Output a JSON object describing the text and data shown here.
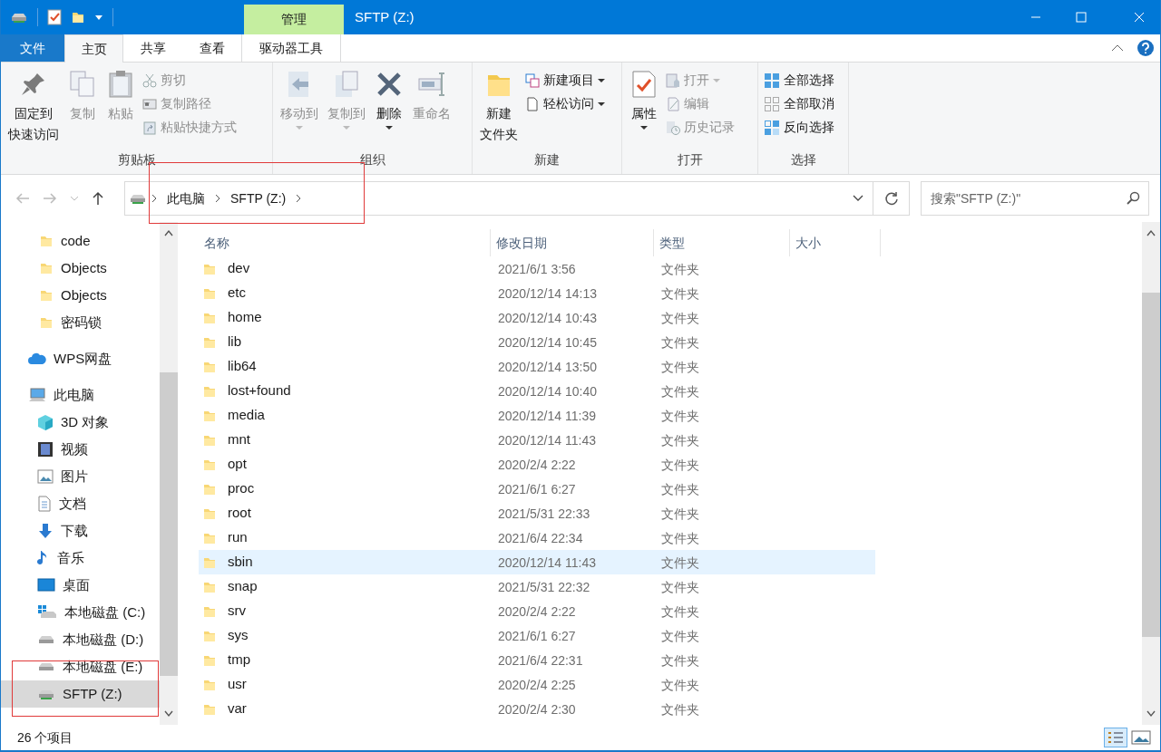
{
  "window": {
    "title": "SFTP (Z:)",
    "context_tab": "管理"
  },
  "ribbon": {
    "tabs": [
      {
        "label": "文件",
        "kind": "file",
        "selected": false
      },
      {
        "label": "主页",
        "kind": "tab",
        "selected": true
      },
      {
        "label": "共享",
        "kind": "tab",
        "selected": false
      },
      {
        "label": "查看",
        "kind": "tab",
        "selected": false
      },
      {
        "label": "驱动器工具",
        "kind": "context",
        "selected": false
      }
    ],
    "groups": [
      {
        "label": "剪贴板",
        "items": [
          {
            "kind": "large",
            "lines": [
              "固定到",
              "快速访问"
            ],
            "disabled": false
          },
          {
            "kind": "large",
            "label": "复制",
            "disabled": true
          },
          {
            "kind": "large",
            "label": "粘贴",
            "disabled": true
          },
          {
            "kind": "small",
            "label": "剪切",
            "disabled": true
          },
          {
            "kind": "small",
            "label": "复制路径",
            "disabled": true
          },
          {
            "kind": "small",
            "label": "粘贴快捷方式",
            "disabled": true
          }
        ]
      },
      {
        "label": "组织",
        "items": [
          {
            "kind": "large",
            "label": "移动到",
            "disabled": true,
            "dropdown": true
          },
          {
            "kind": "large",
            "label": "复制到",
            "disabled": true,
            "dropdown": true
          },
          {
            "kind": "large",
            "label": "删除",
            "disabled": false,
            "dropdown": true
          },
          {
            "kind": "large",
            "label": "重命名",
            "disabled": true
          }
        ]
      },
      {
        "label": "新建",
        "items": [
          {
            "kind": "large",
            "lines": [
              "新建",
              "文件夹"
            ],
            "disabled": false
          },
          {
            "kind": "small",
            "label": "新建项目",
            "disabled": false,
            "dropdown": true
          },
          {
            "kind": "small",
            "label": "轻松访问",
            "disabled": false,
            "dropdown": true
          }
        ]
      },
      {
        "label": "打开",
        "items": [
          {
            "kind": "large",
            "label": "属性",
            "disabled": false,
            "dropdown": true
          },
          {
            "kind": "small",
            "label": "打开",
            "disabled": true,
            "dropdown": true
          },
          {
            "kind": "small",
            "label": "编辑",
            "disabled": true
          },
          {
            "kind": "small",
            "label": "历史记录",
            "disabled": true
          }
        ]
      },
      {
        "label": "选择",
        "items": [
          {
            "kind": "small",
            "label": "全部选择",
            "disabled": false
          },
          {
            "kind": "small",
            "label": "全部取消",
            "disabled": false
          },
          {
            "kind": "small",
            "label": "反向选择",
            "disabled": false
          }
        ]
      }
    ]
  },
  "address": {
    "breadcrumbs": [
      "此电脑",
      "SFTP (Z:)"
    ],
    "highlighted": true
  },
  "search": {
    "placeholder": "搜索\"SFTP (Z:)\""
  },
  "sidebar": {
    "items": [
      {
        "label": "code",
        "kind": "folder",
        "selected": false
      },
      {
        "label": "Objects",
        "kind": "folder",
        "selected": false
      },
      {
        "label": "Objects",
        "kind": "folder",
        "selected": false
      },
      {
        "label": "密码锁",
        "kind": "folder",
        "selected": false
      },
      {
        "label": "WPS网盘",
        "kind": "cloud",
        "selected": false
      },
      {
        "label": "此电脑",
        "kind": "computer",
        "selected": false,
        "children": [
          {
            "label": "3D 对象",
            "kind": "cube",
            "selected": false
          },
          {
            "label": "视频",
            "kind": "video",
            "selected": false
          },
          {
            "label": "图片",
            "kind": "picture",
            "selected": false
          },
          {
            "label": "文档",
            "kind": "document",
            "selected": false
          },
          {
            "label": "下载",
            "kind": "download",
            "selected": false
          },
          {
            "label": "音乐",
            "kind": "music",
            "selected": false
          },
          {
            "label": "桌面",
            "kind": "desktop",
            "selected": false
          },
          {
            "label": "本地磁盘 (C:)",
            "kind": "system-drive",
            "selected": false
          },
          {
            "label": "本地磁盘 (D:)",
            "kind": "drive",
            "selected": false
          },
          {
            "label": "本地磁盘 (E:)",
            "kind": "drive",
            "selected": false
          },
          {
            "label": "SFTP (Z:)",
            "kind": "network-drive",
            "selected": true,
            "highlighted": true
          }
        ]
      }
    ]
  },
  "table": {
    "columns": [
      "名称",
      "修改日期",
      "类型",
      "大小"
    ],
    "rows": [
      {
        "name": "dev",
        "date": "2021/6/1 3:56",
        "type": "文件夹",
        "selected": false
      },
      {
        "name": "etc",
        "date": "2020/12/14 14:13",
        "type": "文件夹",
        "selected": false
      },
      {
        "name": "home",
        "date": "2020/12/14 10:43",
        "type": "文件夹",
        "selected": false
      },
      {
        "name": "lib",
        "date": "2020/12/14 10:45",
        "type": "文件夹",
        "selected": false
      },
      {
        "name": "lib64",
        "date": "2020/12/14 13:50",
        "type": "文件夹",
        "selected": false
      },
      {
        "name": "lost+found",
        "date": "2020/12/14 10:40",
        "type": "文件夹",
        "selected": false
      },
      {
        "name": "media",
        "date": "2020/12/14 11:39",
        "type": "文件夹",
        "selected": false
      },
      {
        "name": "mnt",
        "date": "2020/12/14 11:43",
        "type": "文件夹",
        "selected": false
      },
      {
        "name": "opt",
        "date": "2020/2/4 2:22",
        "type": "文件夹",
        "selected": false
      },
      {
        "name": "proc",
        "date": "2021/6/1 6:27",
        "type": "文件夹",
        "selected": false
      },
      {
        "name": "root",
        "date": "2021/5/31 22:33",
        "type": "文件夹",
        "selected": false
      },
      {
        "name": "run",
        "date": "2021/6/4 22:34",
        "type": "文件夹",
        "selected": false
      },
      {
        "name": "sbin",
        "date": "2020/12/14 11:43",
        "type": "文件夹",
        "selected": true
      },
      {
        "name": "snap",
        "date": "2021/5/31 22:32",
        "type": "文件夹",
        "selected": false
      },
      {
        "name": "srv",
        "date": "2020/2/4 2:22",
        "type": "文件夹",
        "selected": false
      },
      {
        "name": "sys",
        "date": "2021/6/1 6:27",
        "type": "文件夹",
        "selected": false
      },
      {
        "name": "tmp",
        "date": "2021/6/4 22:31",
        "type": "文件夹",
        "selected": false
      },
      {
        "name": "usr",
        "date": "2020/2/4 2:25",
        "type": "文件夹",
        "selected": false
      },
      {
        "name": "var",
        "date": "2020/2/4 2:30",
        "type": "文件夹",
        "selected": false
      }
    ]
  },
  "status_bar": {
    "text": "26 个项目"
  }
}
